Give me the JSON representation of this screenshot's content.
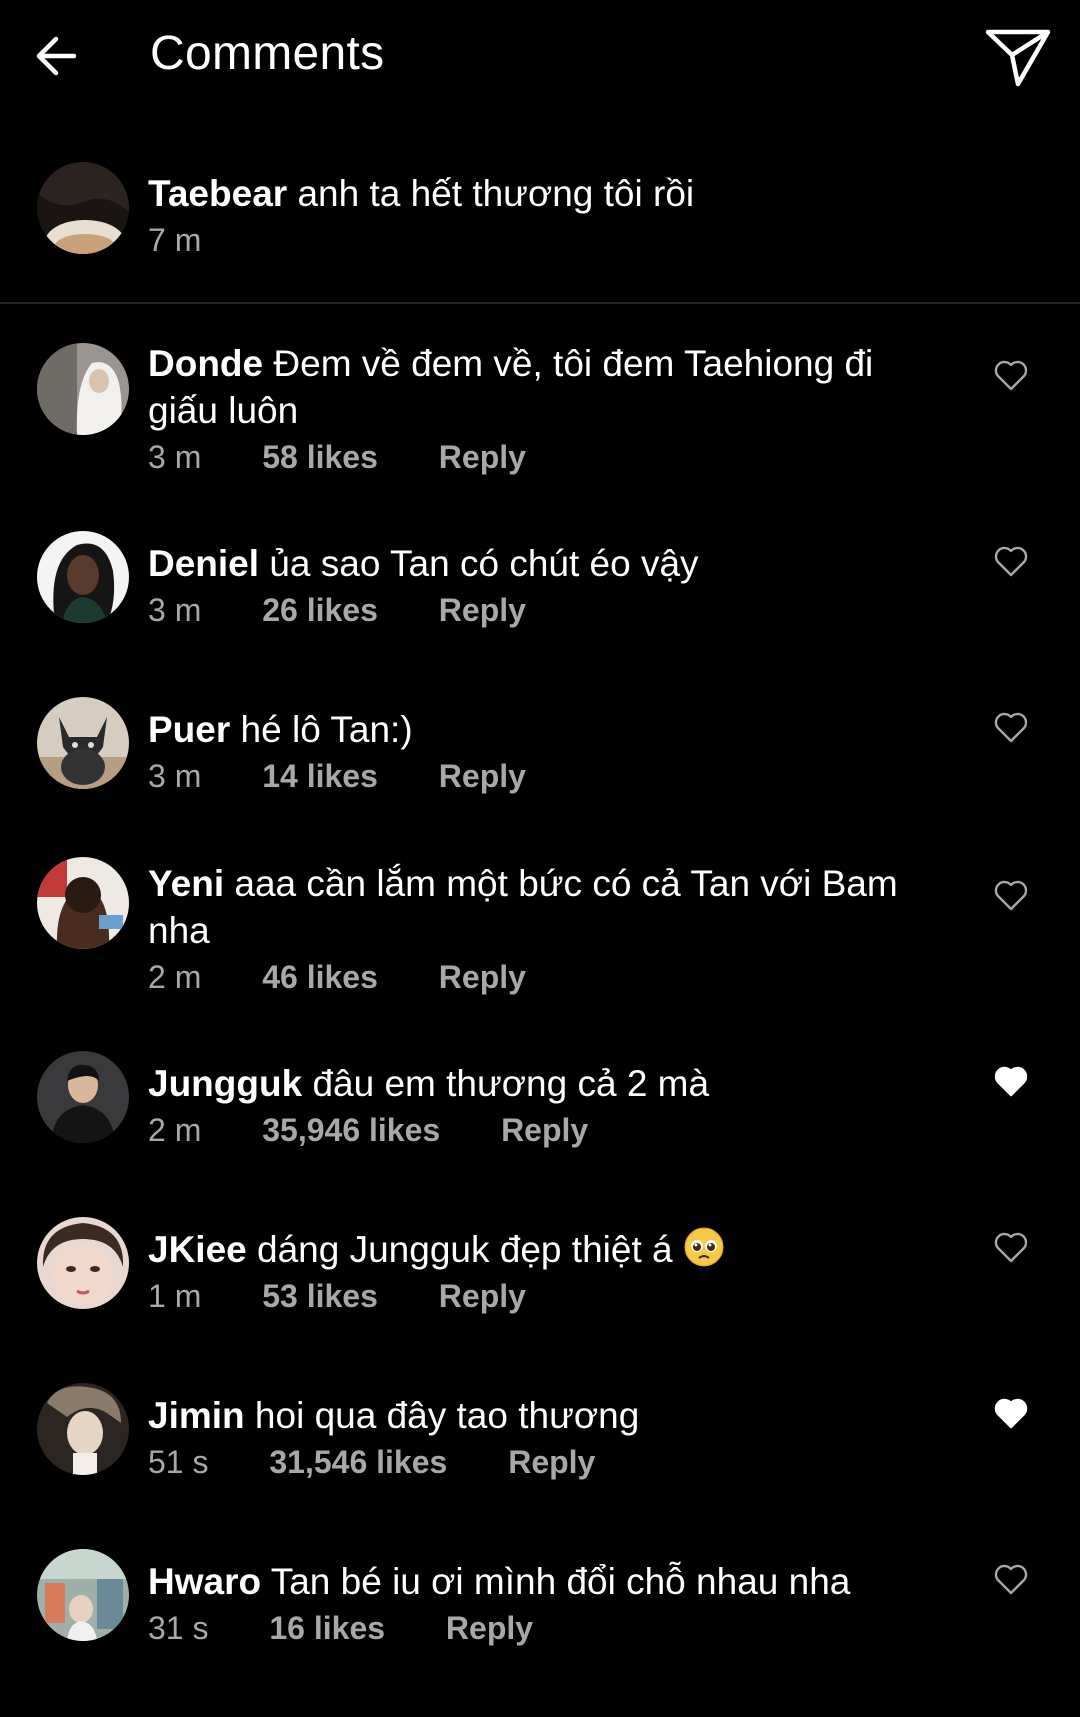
{
  "header": {
    "title": "Comments",
    "back_icon": "arrow-left-icon",
    "share_icon": "paper-plane-icon"
  },
  "caption": {
    "username": "Taebear",
    "text": "anh ta hết thương tôi rồi",
    "time": "7 m"
  },
  "comments": [
    {
      "username": "Donde",
      "text": "Đem về đem về, tôi đem Taehiong đi giấu luôn",
      "time": "3 m",
      "likes": "58 likes",
      "reply": "Reply",
      "liked": false
    },
    {
      "username": "Deniel",
      "text": "ủa sao Tan có chút éo vậy",
      "time": "3 m",
      "likes": "26 likes",
      "reply": "Reply",
      "liked": false
    },
    {
      "username": "Puer",
      "text": "hé lô Tan:)",
      "time": "3 m",
      "likes": "14 likes",
      "reply": "Reply",
      "liked": false
    },
    {
      "username": "Yeni",
      "text": "aaa cần lắm một bức có cả Tan với Bam nha",
      "time": "2 m",
      "likes": "46 likes",
      "reply": "Reply",
      "liked": false
    },
    {
      "username": "Jungguk",
      "text": "đâu em thương cả 2 mà",
      "time": "2 m",
      "likes": "35,946 likes",
      "reply": "Reply",
      "liked": true
    },
    {
      "username": "JKiee",
      "text": "dáng Jungguk đẹp thiệt á",
      "time": "1 m",
      "likes": "53 likes",
      "reply": "Reply",
      "liked": false,
      "emoji": "pleading-face"
    },
    {
      "username": "Jimin",
      "text": "hoi qua đây tao thương",
      "time": "51 s",
      "likes": "31,546 likes",
      "reply": "Reply",
      "liked": true
    },
    {
      "username": "Hwaro",
      "text": "Tan bé iu ơi mình đổi chỗ nhau nha",
      "time": "31 s",
      "likes": "16 likes",
      "reply": "Reply",
      "liked": false
    }
  ],
  "colors": {
    "background": "#000000",
    "text": "#ffffff",
    "meta": "#a8a8a8",
    "divider": "#262626"
  }
}
